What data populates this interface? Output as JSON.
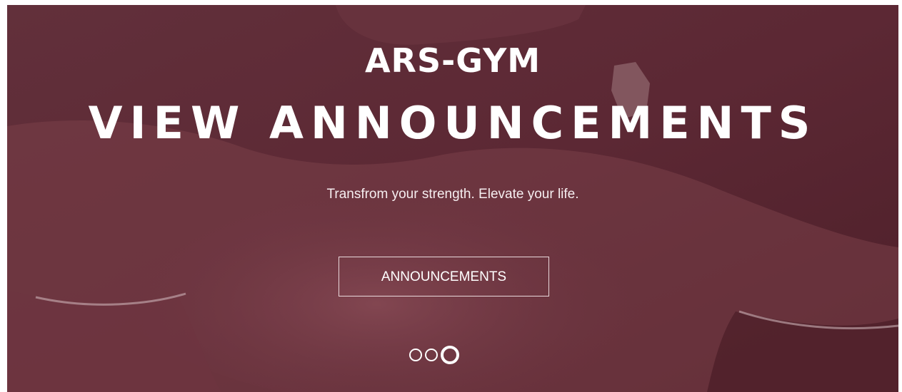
{
  "hero": {
    "brand": "ARS-GYM",
    "headline": "VIEW ANNOUNCEMENTS",
    "tagline": "Transfrom your strength. Elevate your life.",
    "cta_label": "ANNOUNCEMENTS",
    "overlay_color": "#5a2631",
    "text_color": "#ffffff"
  },
  "carousel": {
    "slide_count": 3,
    "active_slide": 3
  }
}
